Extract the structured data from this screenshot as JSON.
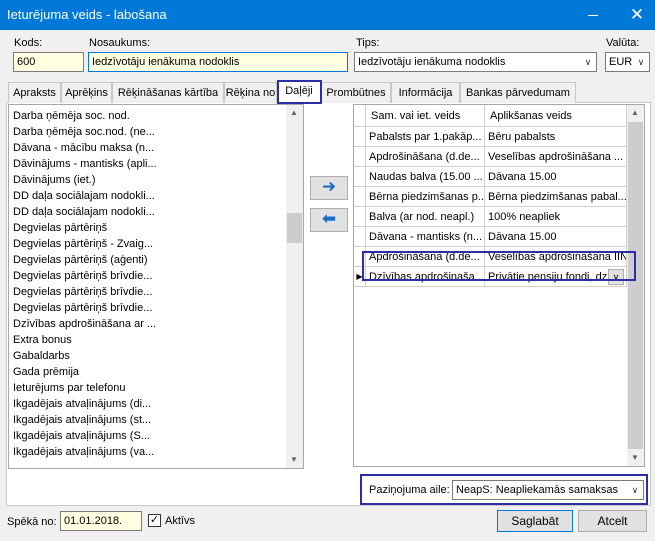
{
  "window": {
    "title": "Ieturējuma veids - labošana",
    "close_glyph": "✕"
  },
  "header": {
    "kods_label": "Kods:",
    "kods_value": "600",
    "nosaukums_label": "Nosaukums:",
    "nosaukums_value": "Iedzīvotāju ienākuma nodoklis",
    "tips_label": "Tips:",
    "tips_value": "Iedzīvotāju ienākuma nodoklis",
    "valuta_label": "Valūta:",
    "valuta_value": "EUR"
  },
  "tabs": [
    {
      "label": "Apraksts"
    },
    {
      "label": "Aprēķins"
    },
    {
      "label": "Rēķināšanas kārtība"
    },
    {
      "label": "Rēķina no"
    },
    {
      "label": "Daļēji"
    },
    {
      "label": "Prombūtnes"
    },
    {
      "label": "Informācija"
    },
    {
      "label": "Bankas pārvedumam"
    }
  ],
  "left_list": [
    "Darba ņēmēja soc. nod.",
    "Darba ņēmēja soc.nod. (ne...",
    "Dāvana - mācību maksa  (n...",
    "Dāvinājums - mantisks (apli...",
    "Dāvinājums (iet.)",
    "DD daļa sociālajam nodokli...",
    "DD daļa sociālajam nodokli...",
    "Degvielas pārtēriņš",
    "Degvielas pārtēriņš - Zvaig...",
    "Degvielas pārtēriņš (aģenti)",
    "Degvielas pārtēriņš brīvdie...",
    "Degvielas pārtēriņš brīvdie...",
    "Degvielas pārtēriņš brīvdie...",
    "Dzīvības apdrošināšana ar ...",
    "Extra bonus",
    "Gabaldarbs",
    "Gada prēmija",
    "Ieturējums par telefonu",
    "Ikgadējais atvaļinājums (di...",
    "Ikgadējais atvaļinājums (st...",
    "Ikgadējais atvaļinājums (S...",
    "Ikgadējais atvaļinājums (va..."
  ],
  "grid": {
    "col1": "Sam. vai iet. veids",
    "col2": "Aplikšanas veids",
    "rows": [
      {
        "c1": "Pabalsts par 1.pakāp...",
        "c2": "Bēru pabalsts"
      },
      {
        "c1": "Apdrošināšana (d.de...",
        "c2": "Veselības apdrošināšana ..."
      },
      {
        "c1": "Naudas balva (15.00 ...",
        "c2": "Dāvana 15.00"
      },
      {
        "c1": "Bērna piedzimšanas p...",
        "c2": "Bērna piedzimšanas pabal..."
      },
      {
        "c1": "Balva (ar nod. neapl.)",
        "c2": "100% neapliek"
      },
      {
        "c1": "Dāvana - mantisks (n...",
        "c2": "Dāvana 15.00"
      },
      {
        "c1": "Apdrošināšana  (d.de...",
        "c2": "Veselības apdrošināšana IIN"
      },
      {
        "c1": "Dzīvības apdrošinaša...",
        "c2": "Privātie pensiju fondi, dz"
      }
    ],
    "current_row_glyph": "▶"
  },
  "bottom": {
    "pazinojuma_label": "Paziņojuma aile:",
    "pazinojuma_value": "NeapS: Neapliekamās samaksas",
    "speka_label": "Spēkā no:",
    "speka_value": "01.01.2018.",
    "aktivs_label": "Aktīvs",
    "aktivs_mark": "✓",
    "save_label": "Saglabāt",
    "cancel_label": "Atcelt"
  },
  "buttons": {
    "add_glyph": "➜",
    "remove_glyph": "⬅"
  },
  "colors": {
    "titlebar": "#0078d7",
    "highlight": "#2c2ea8",
    "field_yellow": "#ffffe1"
  }
}
